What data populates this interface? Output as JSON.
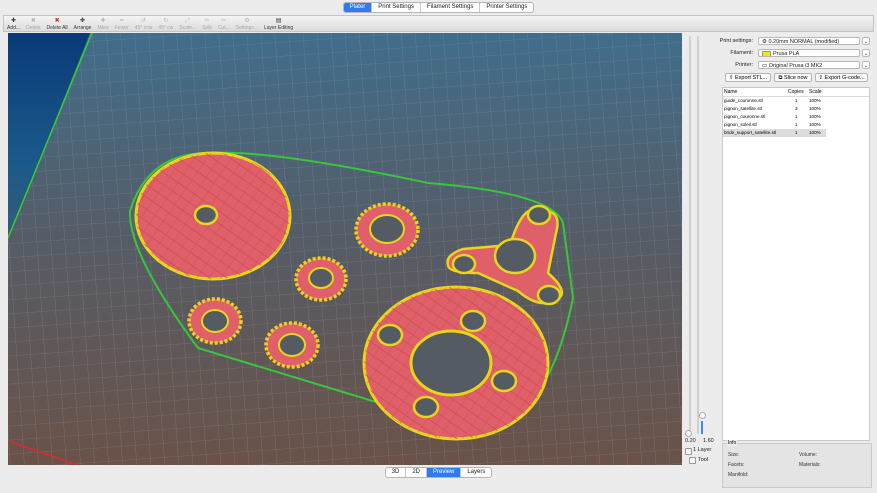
{
  "tabs": [
    "Plater",
    "Print Settings",
    "Filament Settings",
    "Printer Settings"
  ],
  "toolbar": [
    {
      "label": "Add...",
      "icon": "add-icon",
      "glyph": "✚",
      "enabled": true
    },
    {
      "label": "Delete",
      "icon": "delete-icon",
      "glyph": "✖",
      "enabled": false
    },
    {
      "label": "Delete All",
      "icon": "delete-all-icon",
      "glyph": "✖",
      "enabled": true
    },
    {
      "label": "Arrange",
      "icon": "arrange-icon",
      "glyph": "✤",
      "enabled": true
    },
    {
      "label": "More",
      "icon": "more-icon",
      "glyph": "✚",
      "enabled": false
    },
    {
      "label": "Fewer",
      "icon": "fewer-icon",
      "glyph": "━",
      "enabled": false
    },
    {
      "label": "45° ccw",
      "icon": "rotate-ccw-icon",
      "glyph": "↺",
      "enabled": false
    },
    {
      "label": "45° cw",
      "icon": "rotate-cw-icon",
      "glyph": "↻",
      "enabled": false
    },
    {
      "label": "Scale...",
      "icon": "scale-icon",
      "glyph": "⤢",
      "enabled": false
    },
    {
      "label": "Split",
      "icon": "split-icon",
      "glyph": "✂",
      "enabled": false
    },
    {
      "label": "Cut...",
      "icon": "cut-icon",
      "glyph": "✂",
      "enabled": false
    },
    {
      "label": "Settings...",
      "icon": "settings-icon",
      "glyph": "⚙",
      "enabled": false
    },
    {
      "label": "Layer Editing",
      "icon": "layer-editing-icon",
      "glyph": "▤",
      "enabled": true
    }
  ],
  "settings": {
    "print_label": "Print settings:",
    "print_value": "0.20mm NORMAL (modified)",
    "filament_label": "Filament:",
    "filament_value": "Prusa PLA",
    "filament_color": "#f5e61a",
    "printer_label": "Printer:",
    "printer_value": "Original Prusa i3 MK2"
  },
  "actions": {
    "export_stl": "Export STL...",
    "slice_now": "Slice now",
    "export_gcode": "Export G-code..."
  },
  "objects": {
    "headers": [
      "Name",
      "Copies",
      "Scale"
    ],
    "rows": [
      {
        "name": "guide_couronne.stl",
        "copies": "1",
        "scale": "100%"
      },
      {
        "name": "pignon_satellite.stl",
        "copies": "3",
        "scale": "100%"
      },
      {
        "name": "pignon_couronne.stl",
        "copies": "1",
        "scale": "100%"
      },
      {
        "name": "pignon_soleil.stl",
        "copies": "1",
        "scale": "100%"
      },
      {
        "name": "bride_support_satellite.stl",
        "copies": "1",
        "scale": "100%"
      }
    ]
  },
  "layers": {
    "min": "0.20",
    "max": "1.60",
    "one_layer": "1 Layer",
    "tool": "Tool"
  },
  "info": {
    "title": "Info",
    "size": "Size:",
    "volume": "Volume:",
    "facets": "Facets:",
    "materials": "Materials:",
    "manifold": "Manifold:"
  },
  "view_tabs": [
    "3D",
    "2D",
    "Preview",
    "Layers"
  ],
  "colors": {
    "accent": "#2f7bf5",
    "fill": "#e0606a",
    "perimeter": "#e8d61a",
    "skirt": "#38c63c"
  }
}
